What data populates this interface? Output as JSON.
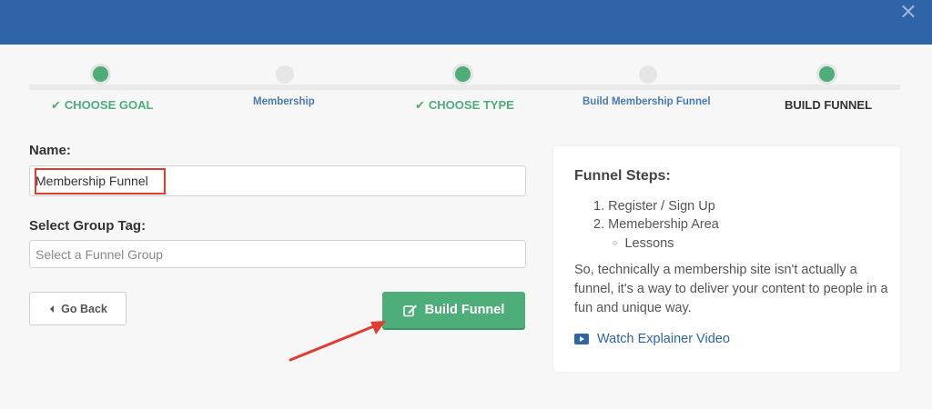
{
  "modal": {
    "close_glyph": "×",
    "header_color": "#2f65a8"
  },
  "steps": [
    {
      "label": "CHOOSE GOAL",
      "state": "done"
    },
    {
      "label": "Membership",
      "state": "mid"
    },
    {
      "label": "CHOOSE TYPE",
      "state": "done"
    },
    {
      "label": "Build Membership Funnel",
      "state": "mid"
    },
    {
      "label": "BUILD FUNNEL",
      "state": "current"
    }
  ],
  "form": {
    "name_label": "Name:",
    "name_value": "Membership Funnel",
    "group_label": "Select Group Tag:",
    "group_placeholder": "Select a Funnel Group"
  },
  "buttons": {
    "back": "Go Back",
    "build": "Build Funnel"
  },
  "panel": {
    "title": "Funnel Steps:",
    "steps": [
      "1. Register / Sign Up",
      "2. Memebership Area",
      "Lessons"
    ],
    "description": "So, technically a membership site isn't actually a funnel, it's a way to deliver your content to people in a fun and unique way.",
    "video_link": "Watch Explainer Video"
  },
  "colors": {
    "accent_green": "#4dae79",
    "link_blue": "#2f65a8",
    "annotation_red": "#e03c2f"
  }
}
